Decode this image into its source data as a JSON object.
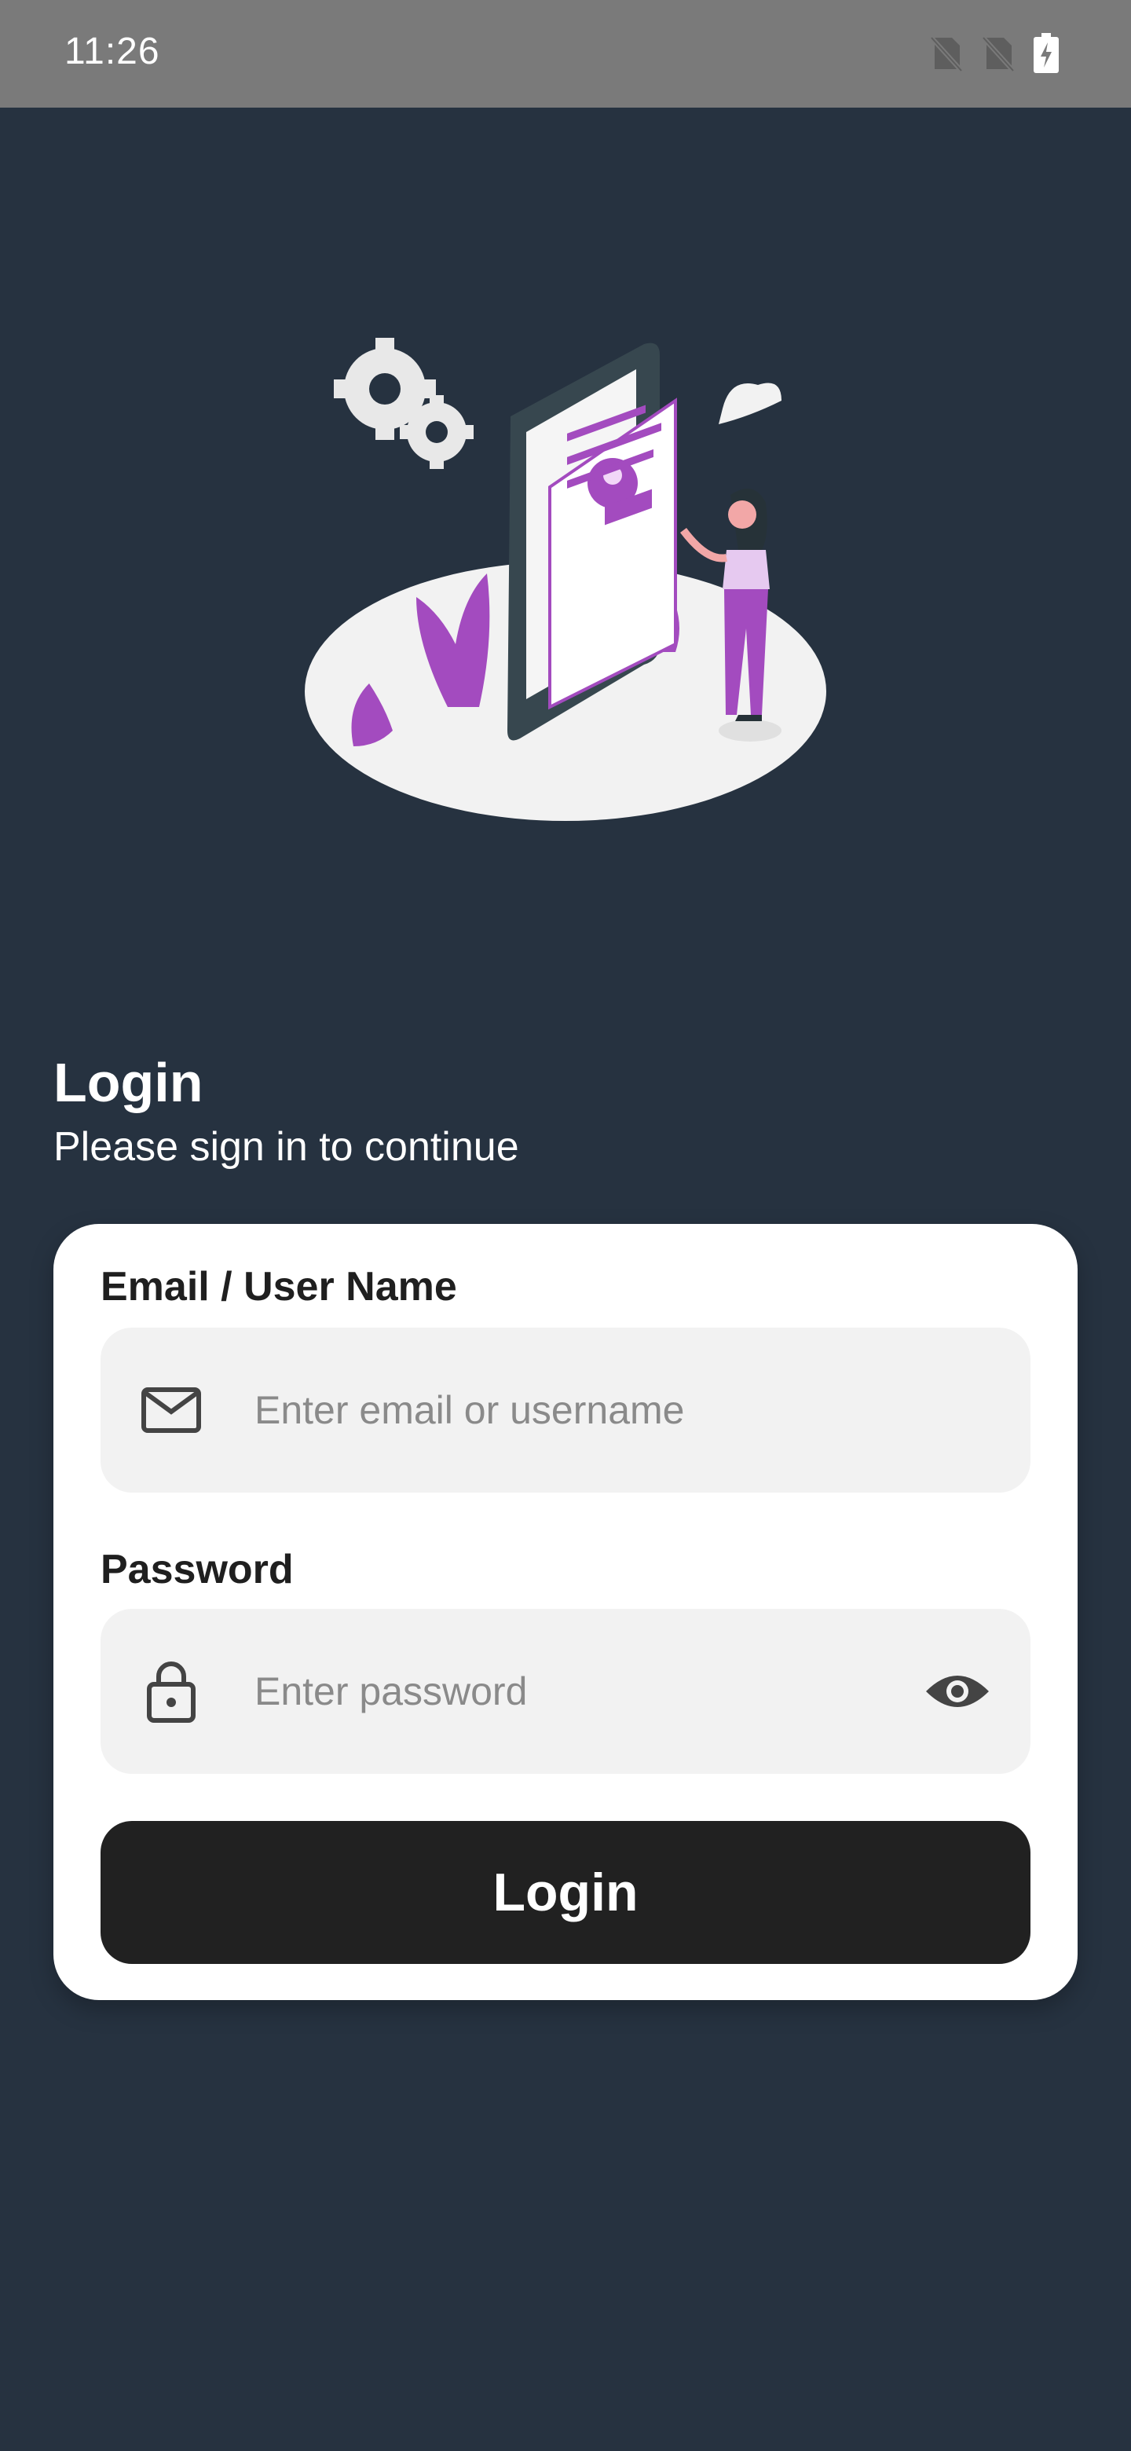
{
  "status_bar": {
    "time": "11:26",
    "icons": [
      "no-sim-icon",
      "no-sim-icon",
      "battery-charging-icon"
    ]
  },
  "illustration": {
    "name": "phone-profile-illustration",
    "colors": {
      "accent": "#a34bbf",
      "platform": "#f2f2f2",
      "phone": "#37474f"
    }
  },
  "header": {
    "title": "Login",
    "subtitle": "Please sign in to continue"
  },
  "form": {
    "email": {
      "label": "Email / User Name",
      "placeholder": "Enter email or username",
      "value": "",
      "icon": "mail-icon"
    },
    "password": {
      "label": "Password",
      "placeholder": "Enter password",
      "value": "",
      "icon": "lock-icon",
      "toggle_icon": "eye-icon"
    },
    "submit_label": "Login"
  },
  "colors": {
    "background": "#263240",
    "card": "#ffffff",
    "field": "#f2f2f2",
    "button": "#212121"
  }
}
